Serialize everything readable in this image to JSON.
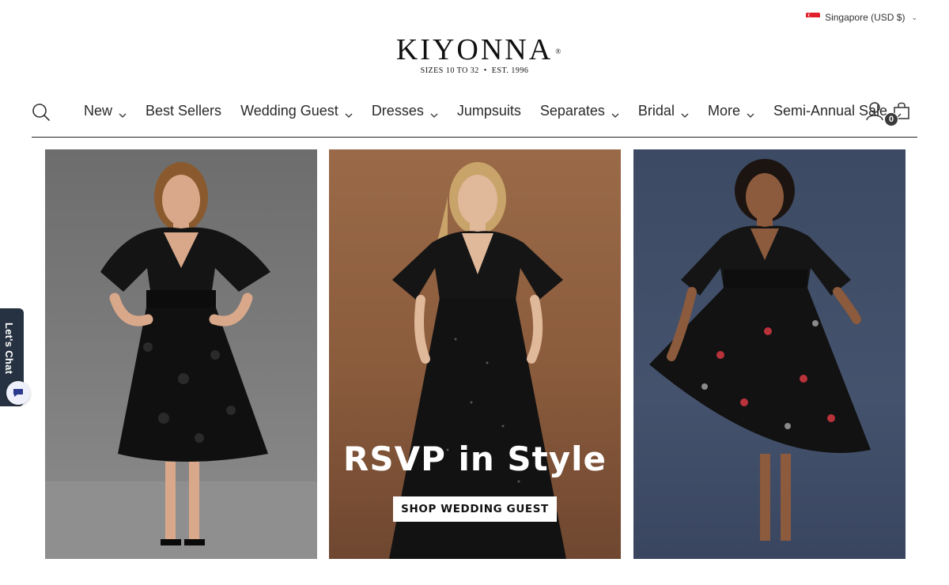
{
  "currency": {
    "label": "Singapore (USD $)",
    "flag_icon": "singapore-flag-icon"
  },
  "logo": {
    "word": "KIYONNA",
    "registered": "®",
    "tagline": "SIZES 10 TO 32  •  EST. 1996"
  },
  "nav": {
    "items": [
      {
        "label": "New",
        "dropdown": true
      },
      {
        "label": "Best Sellers",
        "dropdown": false
      },
      {
        "label": "Wedding Guest",
        "dropdown": true
      },
      {
        "label": "Dresses",
        "dropdown": true
      },
      {
        "label": "Jumpsuits",
        "dropdown": false
      },
      {
        "label": "Separates",
        "dropdown": true
      },
      {
        "label": "Bridal",
        "dropdown": true
      },
      {
        "label": "More",
        "dropdown": true
      },
      {
        "label": "Semi-Annual Sale",
        "dropdown": true
      }
    ],
    "cart_count": "0"
  },
  "hero": {
    "title": "RSVP in Style",
    "cta": "SHOP WEDDING GUEST"
  },
  "chat": {
    "label": "Let's Chat"
  },
  "colors": {
    "panel_left_bg": "#7a7a7a",
    "panel_center_bg": "#8a5b3c",
    "panel_right_bg": "#44526d",
    "chat_tab_bg": "#263241"
  }
}
